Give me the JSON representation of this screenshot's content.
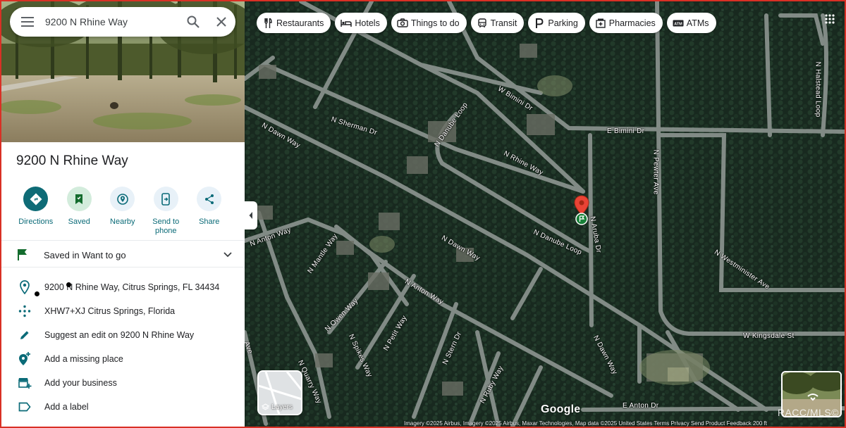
{
  "search": {
    "value": "9200 N Rhine Way"
  },
  "place": {
    "title": "9200 N Rhine Way"
  },
  "actions": [
    {
      "label": "Directions",
      "icon": "directions-icon"
    },
    {
      "label": "Saved",
      "icon": "bookmark-icon"
    },
    {
      "label": "Nearby",
      "icon": "nearby-icon"
    },
    {
      "label": "Send to phone",
      "icon": "send-to-phone-icon"
    },
    {
      "label": "Share",
      "icon": "share-icon"
    }
  ],
  "saved_list": {
    "label": "Saved in Want to go"
  },
  "info": {
    "address": "9200 N Rhine Way, Citrus Springs, FL 34434",
    "plus_code": "XHW7+XJ Citrus Springs, Florida",
    "suggest_edit": "Suggest an edit on 9200 N Rhine Way",
    "add_missing": "Add a missing place",
    "add_business": "Add your business",
    "add_label": "Add a label"
  },
  "chips": [
    {
      "label": "Restaurants",
      "icon": "fork-knife-icon"
    },
    {
      "label": "Hotels",
      "icon": "bed-icon"
    },
    {
      "label": "Things to do",
      "icon": "camera-icon"
    },
    {
      "label": "Transit",
      "icon": "bus-icon"
    },
    {
      "label": "Parking",
      "icon": "parking-icon"
    },
    {
      "label": "Pharmacies",
      "icon": "pharmacy-icon"
    },
    {
      "label": "ATMs",
      "icon": "atm-icon"
    }
  ],
  "map": {
    "roads": {
      "sherman": "N Sherman Dr",
      "dawn_w": "N Dawn Way",
      "dawn_mid": "N Dawn Way",
      "dawn_s": "N Dawn Way",
      "danube_loop_n": "N Danube Loop",
      "danube_loop_s": "N Danube Loop",
      "rhine": "N Rhine Way",
      "bimini_w": "W Bimini Dr",
      "bimini_e": "E Bimini Dr",
      "pewter": "N Pewter Ave",
      "halstead": "N Halstead Loop",
      "aruba": "N Aruba Dr",
      "anton_w": "N Anton Way",
      "anton_mid": "N Anton Way",
      "mantle": "N Mantle Way",
      "owen": "N Owen Way",
      "spikes": "N Spikes Way",
      "petit": "N Petit Way",
      "stern": "N Stern Dr",
      "ruby": "N Ruby Way",
      "quarry": "N Quarry Way",
      "westminister": "N Westminister Ave",
      "kingsdale": "W Kingsdale St",
      "anton_e": "E Anton Dr",
      "edge_ave": "Ave"
    },
    "layers_label": "Layers",
    "logo": "Google",
    "attribution": "Imagery ©2025 Airbus, Imagery ©2025 Airbus, Maxar Technologies, Map data ©2025   United States   Terms   Privacy   Send Product Feedback   200 ft",
    "watermark": "RACC/MLS©"
  }
}
